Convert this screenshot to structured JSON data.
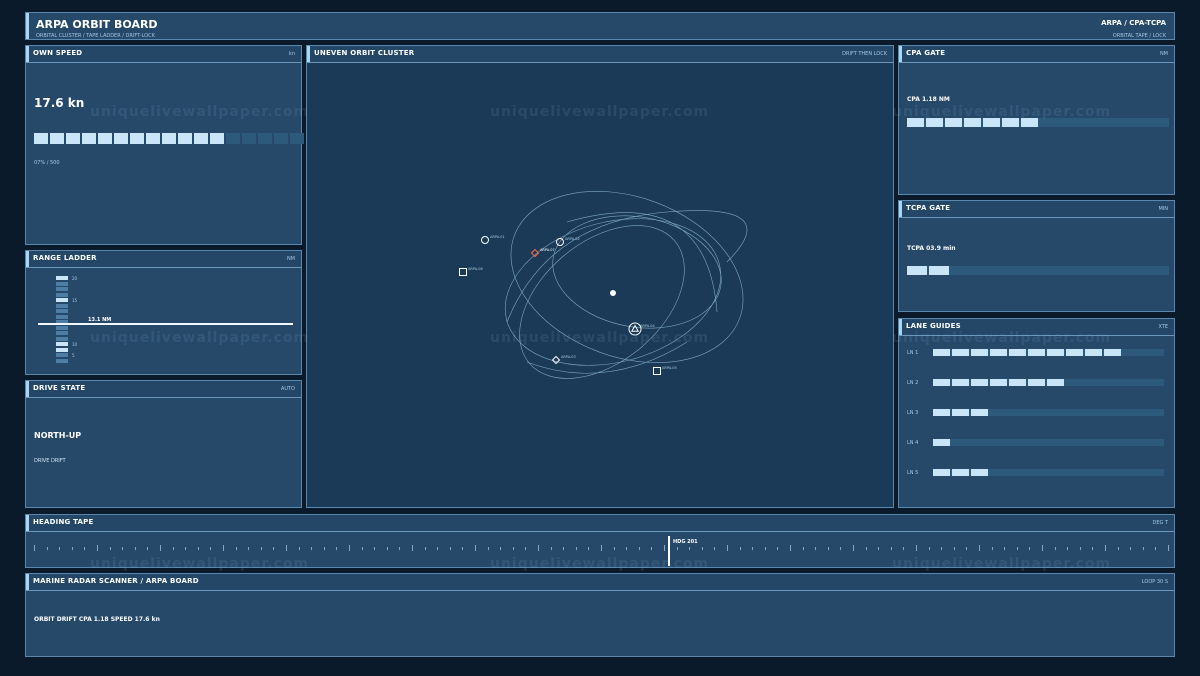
{
  "header": {
    "title": "ARPA ORBIT BOARD",
    "subtitle": "ORBITAL CLUSTER / TAPE LADDER / DRIFT-LOCK",
    "right_title": "ARPA / CPA-TCPA",
    "right_sub": "ORBITAL TAPE / LOCK"
  },
  "own_speed": {
    "title": "OWN SPEED",
    "tag": "kn",
    "value": "17.6 kn",
    "segments_filled": 12,
    "segments_total": 17,
    "note": "07%",
    "note2": "/ 500"
  },
  "range_ladder": {
    "title": "RANGE LADDER",
    "tag": "NM",
    "marker_label": "13.1 NM",
    "tick_labels": [
      "20",
      "15",
      "10",
      "5"
    ]
  },
  "drive_state": {
    "title": "DRIVE STATE",
    "tag": "AUTO",
    "value": "NORTH-UP",
    "sub": "DRIVE DRIFT"
  },
  "orbit": {
    "title": "UNEVEN ORBIT CLUSTER",
    "tag": "DRIFT THEN LOCK",
    "targets": [
      {
        "label": "ARPA-01",
        "shape": "circle"
      },
      {
        "label": "ARPA-02",
        "shape": "circle"
      },
      {
        "label": "ARPA-07",
        "shape": "diamond-alert"
      },
      {
        "label": "ARPA-08",
        "shape": "square"
      },
      {
        "label": "ARPA-04",
        "shape": "triangle-circle"
      },
      {
        "label": "ARPA-03",
        "shape": "diamond"
      },
      {
        "label": "ARPA-05",
        "shape": "square"
      }
    ]
  },
  "cpa_gate": {
    "title": "CPA GATE",
    "tag": "NM",
    "value": "CPA  1.18 NM",
    "filled": 7,
    "total": 14
  },
  "tcpa_gate": {
    "title": "TCPA GATE",
    "tag": "MIN",
    "value": "TCPA  03.9 min",
    "filled": 2,
    "total": 14
  },
  "lane_guides": {
    "title": "LANE GUIDES",
    "tag": "XTE",
    "lanes": [
      {
        "label": "LN 1",
        "filled": 10
      },
      {
        "label": "LN 2",
        "filled": 7
      },
      {
        "label": "LN 3",
        "filled": 3
      },
      {
        "label": "LN 4",
        "filled": 1
      },
      {
        "label": "LN 5",
        "filled": 3
      }
    ],
    "total": 12
  },
  "heading_tape": {
    "title": "HEADING TAPE",
    "tag": "DEG T",
    "marker_label": "HDG 201"
  },
  "footer": {
    "title": "MARINE RADAR SCANNER / ARPA BOARD",
    "tag": "LOOP 30 S",
    "status": "ORBIT DRIFT  CPA 1.18  SPEED 17.6 kn"
  },
  "watermark": "uniquelivewallpaper.com",
  "colors": {
    "panel": "#26496a",
    "border": "#5a88ad",
    "accent": "#a7d6f3",
    "segment": "#c9e6f8",
    "alert": "#ff6a3d"
  }
}
